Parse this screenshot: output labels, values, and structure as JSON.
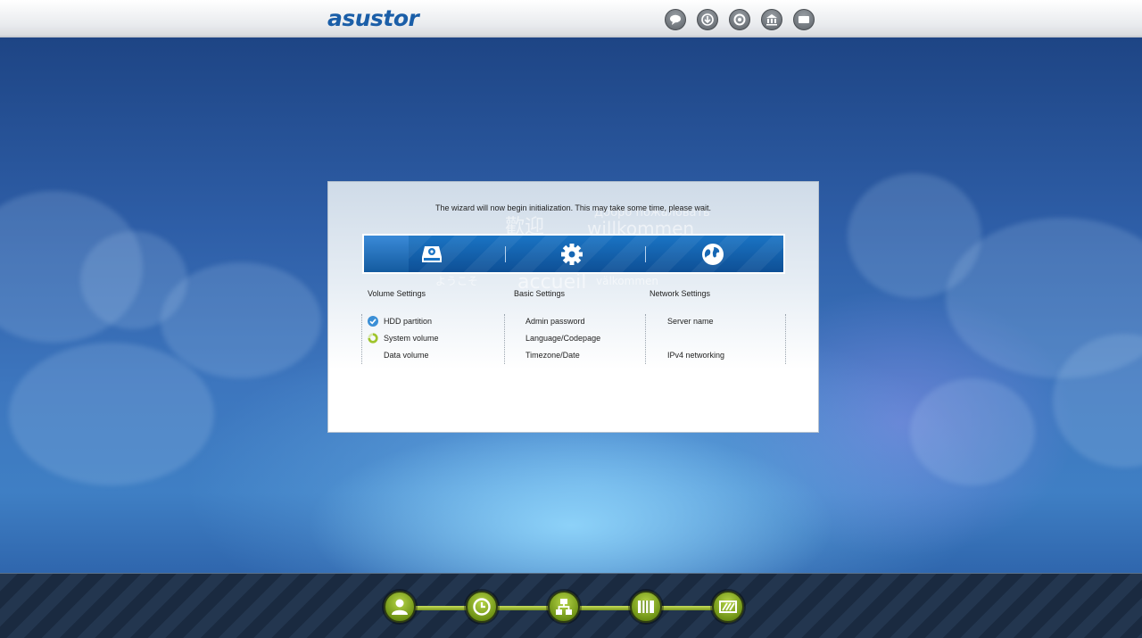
{
  "header": {
    "logo_text": "asustor",
    "icons": [
      "chat-icon",
      "download-icon",
      "support-icon",
      "museum-icon",
      "display-icon"
    ]
  },
  "dialog": {
    "message": "The wizard will now begin initialization. This may take some time, please wait.",
    "watermark_words": [
      "歡迎",
      "Добро пожаловать",
      "willkommen",
      "ようこそ",
      "accueil",
      "välkommen"
    ],
    "step_icons": [
      "hdd-settings-icon",
      "gear-icon",
      "globe-icon"
    ],
    "columns": [
      {
        "title": "Volume Settings",
        "items": [
          {
            "label": "HDD partition",
            "status": "done"
          },
          {
            "label": "System volume",
            "status": "in-progress"
          },
          {
            "label": "Data volume",
            "status": "pending"
          }
        ]
      },
      {
        "title": "Basic Settings",
        "items": [
          {
            "label": "Admin password"
          },
          {
            "label": "Language/Codepage"
          },
          {
            "label": "Timezone/Date"
          }
        ]
      },
      {
        "title": "Network Settings",
        "items": [
          {
            "label": "Server name"
          },
          {
            "label": "IPv4 networking"
          }
        ]
      }
    ]
  },
  "footer": {
    "progress_icons": [
      "user-icon",
      "clock-icon",
      "network-icon",
      "storage-icon",
      "finish-icon"
    ]
  },
  "colors": {
    "brand_blue": "#1a5ea8",
    "step_bar": "#0e4f95",
    "progress_green": "#8fb320",
    "done_check": "#3b8fd6",
    "in_progress": "#9fc42c"
  }
}
